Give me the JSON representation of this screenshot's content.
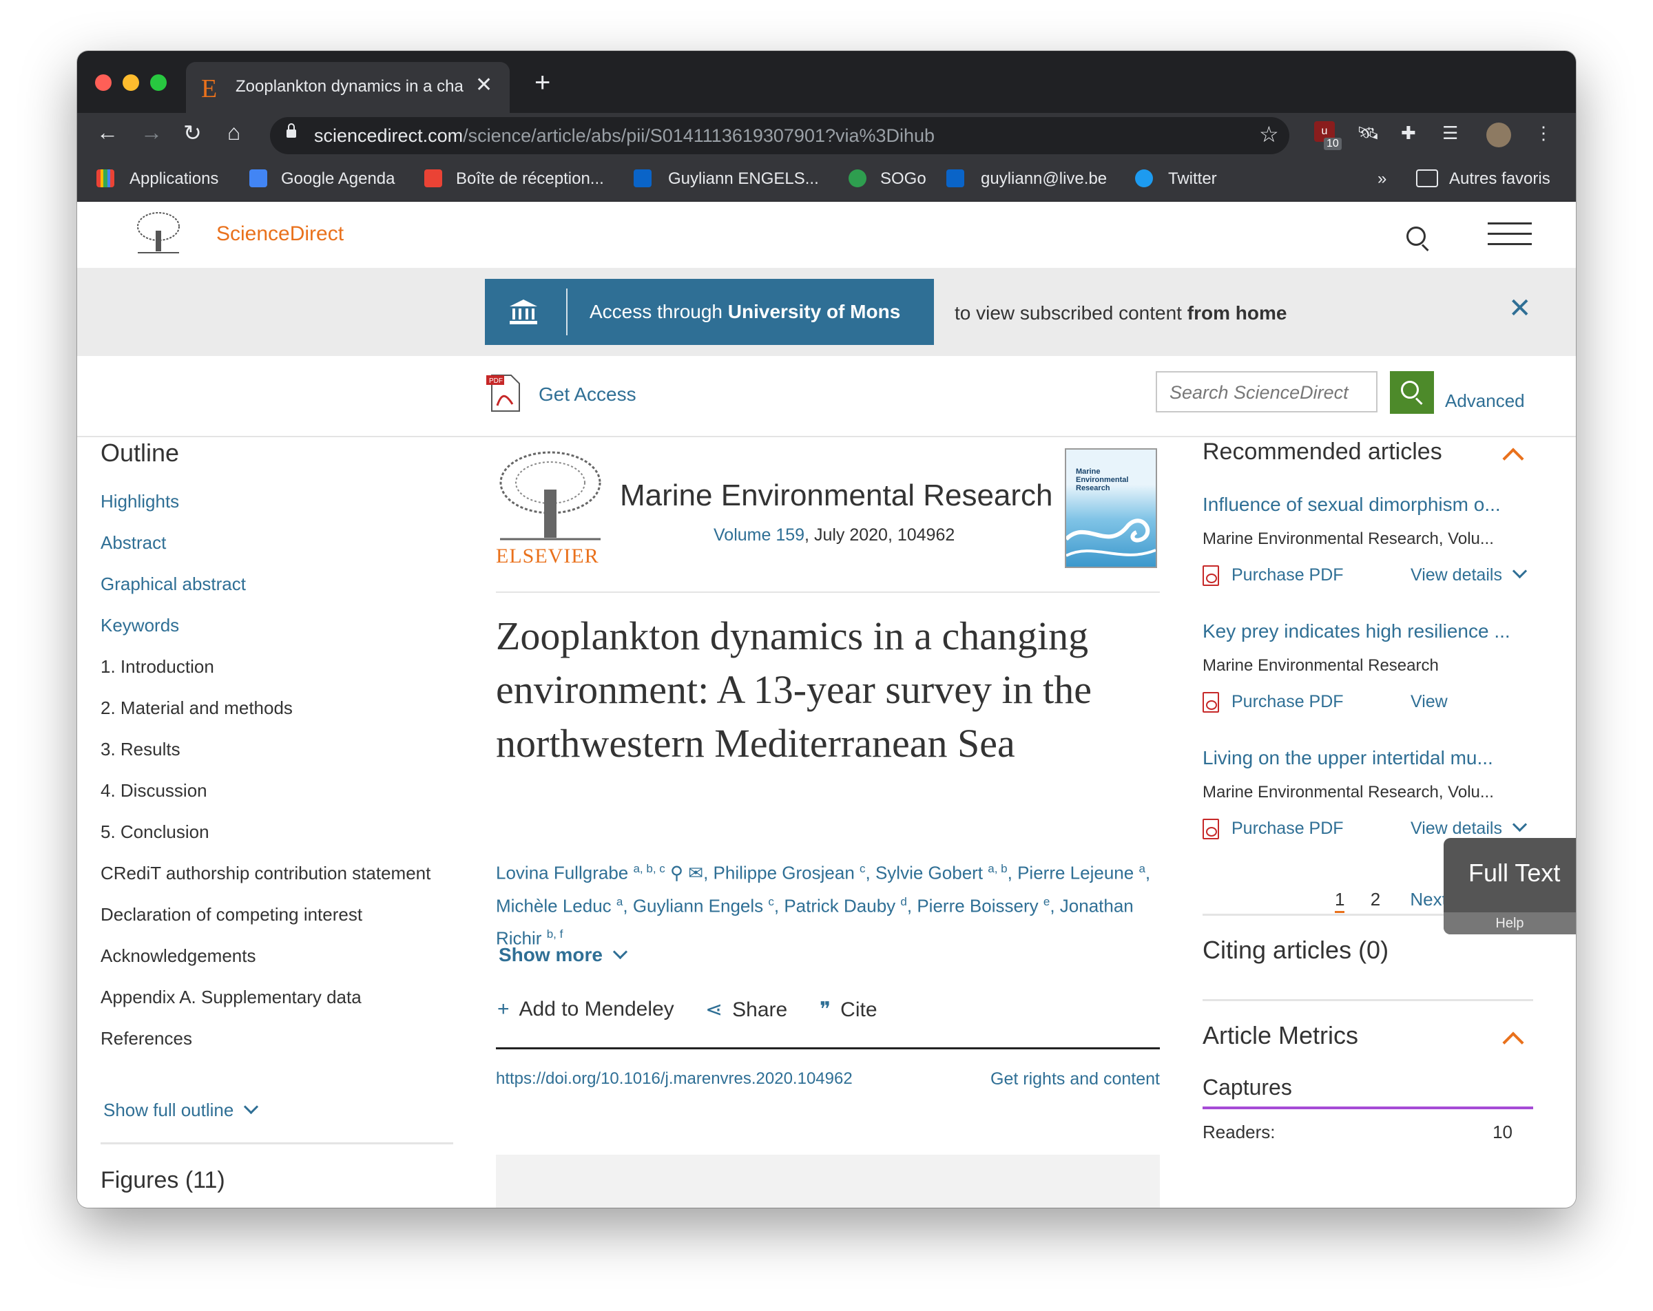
{
  "browser": {
    "tab_title": "Zooplankton dynamics in a cha",
    "tab_favicon": "E",
    "url_host": "sciencedirect.com",
    "url_path": "/science/article/abs/pii/S0141113619307901?via%3Dihub",
    "ext_badge_count": "10",
    "bookmarks": [
      {
        "label": "Applications",
        "icon": "apps-grid-icon"
      },
      {
        "label": "Google Agenda",
        "icon": "calendar-icon"
      },
      {
        "label": "Boîte de réception...",
        "icon": "gmail-icon"
      },
      {
        "label": "Guyliann ENGELS...",
        "icon": "outlook-icon"
      },
      {
        "label": "SOGo",
        "icon": "sogo-icon"
      },
      {
        "label": "guyliann@live.be",
        "icon": "outlook-icon"
      },
      {
        "label": "Twitter",
        "icon": "twitter-icon"
      }
    ],
    "bookmarks_overflow": "»",
    "other_bookmarks": "Autres favoris"
  },
  "header": {
    "brand": "ScienceDirect"
  },
  "banner": {
    "access_prefix": "Access through ",
    "institution": "University of Mons",
    "message_prefix": "to view subscribed content ",
    "message_bold": "from home"
  },
  "access": {
    "get_access": "Get Access",
    "search_placeholder": "Search ScienceDirect",
    "advanced": "Advanced"
  },
  "outline": {
    "title": "Outline",
    "items": [
      {
        "label": "Highlights",
        "link": true
      },
      {
        "label": "Abstract",
        "link": true
      },
      {
        "label": "Graphical abstract",
        "link": true
      },
      {
        "label": "Keywords",
        "link": true
      },
      {
        "label": "1. Introduction",
        "link": false
      },
      {
        "label": "2. Material and methods",
        "link": false
      },
      {
        "label": "3. Results",
        "link": false
      },
      {
        "label": "4. Discussion",
        "link": false
      },
      {
        "label": "5. Conclusion",
        "link": false
      },
      {
        "label": "CRediT authorship contribution statement",
        "link": false
      },
      {
        "label": "Declaration of competing interest",
        "link": false
      },
      {
        "label": "Acknowledgements",
        "link": false
      },
      {
        "label": "Appendix A. Supplementary data",
        "link": false
      },
      {
        "label": "References",
        "link": false
      }
    ],
    "show_full": "Show full outline",
    "figures": "Figures (11)"
  },
  "article": {
    "publisher": "ELSEVIER",
    "journal": "Marine Environmental Research",
    "volume": "Volume 159",
    "date_id": ", July 2020, 104962",
    "cover_title": "Marine Environmental Research",
    "title": "Zooplankton dynamics in a changing environment: A 13-year survey in the northwestern Mediterranean Sea",
    "authors": [
      {
        "name": "Lovina Fullgrabe",
        "sup": "a, b, c",
        "icons": true
      },
      {
        "name": "Philippe Grosjean",
        "sup": "c"
      },
      {
        "name": "Sylvie Gobert",
        "sup": "a, b"
      },
      {
        "name": "Pierre Lejeune",
        "sup": "a"
      },
      {
        "name": "Michèle Leduc",
        "sup": "a"
      },
      {
        "name": "Guyliann Engels",
        "sup": "c"
      },
      {
        "name": "Patrick Dauby",
        "sup": "d"
      },
      {
        "name": "Pierre Boissery",
        "sup": "e"
      },
      {
        "name": "Jonathan Richir",
        "sup": "b, f"
      }
    ],
    "show_more": "Show more",
    "actions": {
      "mendeley": "Add to Mendeley",
      "share": "Share",
      "cite": "Cite"
    },
    "doi": "https://doi.org/10.1016/j.marenvres.2020.104962",
    "rights": "Get rights and content"
  },
  "recommended": {
    "title": "Recommended articles",
    "items": [
      {
        "title": "Influence of sexual dimorphism o...",
        "source": "Marine Environmental Research, Volu...",
        "purchase": "Purchase PDF",
        "details": "View details"
      },
      {
        "title": "Key prey indicates high resilience ...",
        "source": "Marine Environmental Research",
        "purchase": "Purchase PDF",
        "details": "View"
      },
      {
        "title": "Living on the upper intertidal mu...",
        "source": "Marine Environmental Research, Volu...",
        "purchase": "Purchase PDF",
        "details": "View details"
      }
    ],
    "pager": {
      "current": "1",
      "other": "2",
      "next": "Next"
    }
  },
  "citing": "Citing articles (0)",
  "metrics": {
    "title": "Article Metrics",
    "captures": "Captures",
    "readers_label": "Readers:",
    "readers_value": "10"
  },
  "fulltext_widget": {
    "label": "Full Text",
    "help": "Help"
  }
}
